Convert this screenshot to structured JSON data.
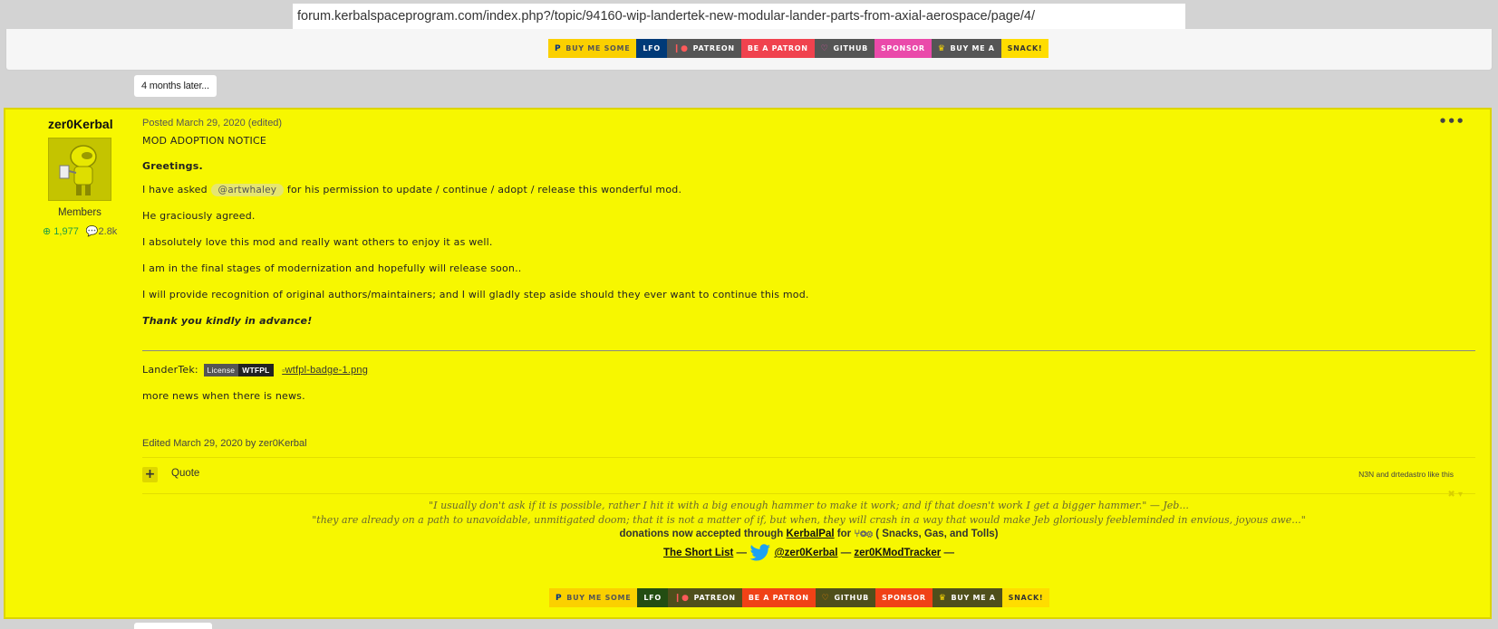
{
  "browser": {
    "url": "forum.kerbalspaceprogram.com/index.php?/topic/94160-wip-landertek-new-modular-lander-parts-from-axial-aerospace/page/4/"
  },
  "separator": {
    "label": "4 months later..."
  },
  "badges": [
    {
      "text": "BUY ME SOME",
      "icon": "P"
    },
    {
      "text": "LFO"
    },
    {
      "text": "PATREON",
      "icon": "❙●"
    },
    {
      "text": "BE A PATRON"
    },
    {
      "text": "GITHUB",
      "icon": "♡"
    },
    {
      "text": "SPONSOR"
    },
    {
      "text": "BUY ME A",
      "icon": "♛"
    },
    {
      "text": "SNACK!"
    }
  ],
  "post": {
    "author": {
      "name": "zer0Kerbal",
      "group": "Members",
      "reputation": "1,977",
      "posts": "2.8k"
    },
    "meta": "Posted March 29, 2020 (edited)",
    "menu_icon": "•••",
    "body": {
      "heading": "MOD ADOPTION NOTICE",
      "greeting": "Greetings.",
      "asked_pre": "I have asked",
      "mention": "@artwhaley",
      "asked_post": "for his permission to update / continue / adopt / release this wonderful mod.",
      "agreed": "He graciously agreed.",
      "love": "I absolutely love this mod and really want others to enjoy it as well.",
      "stages": "I am in the final stages of modernization and hopefully will release soon..",
      "recognition": "I will provide recognition of original authors/maintainers; and I will gladly step aside should they ever want to continue this mod.",
      "thanks": "Thank you kindly in advance!",
      "landertek_label": "LanderTek:",
      "license_label": "License",
      "license_value": "WTFPL",
      "broken_image": "wtfpl-badge-1.png",
      "news": "more news when there is news."
    },
    "edited": "Edited March 29, 2020 by zer0Kerbal",
    "quote_label": "Quote",
    "likes": "N3N and drtedastro like this",
    "signature": {
      "quote1": "\"I usually don't ask if it is possible, rather I hit it with a big enough hammer to make it work; and if that doesn't work I get a bigger hammer.\"  — Jeb...",
      "quote2": "\"they are already on a path to unavoidable, unmitigated doom; that it is not a matter of if, but when, they will crash in a way that would make Jeb gloriously feebleminded in envious, joyous awe...\"",
      "donation_pre": "donations now accepted through",
      "donation_link": "KerbalPal",
      "donation_mid": "for",
      "donation_post": "( Snacks, Gas, and Tolls)",
      "shortlist": "The Short List",
      "dash1": "—",
      "twitter": "@zer0Kerbal",
      "dash2": " — ",
      "tracker": "zer0KModTracker",
      "dash3": "—"
    }
  },
  "colors": {
    "post_bg": "#f7f700",
    "page_bg": "#d3d3d3"
  }
}
